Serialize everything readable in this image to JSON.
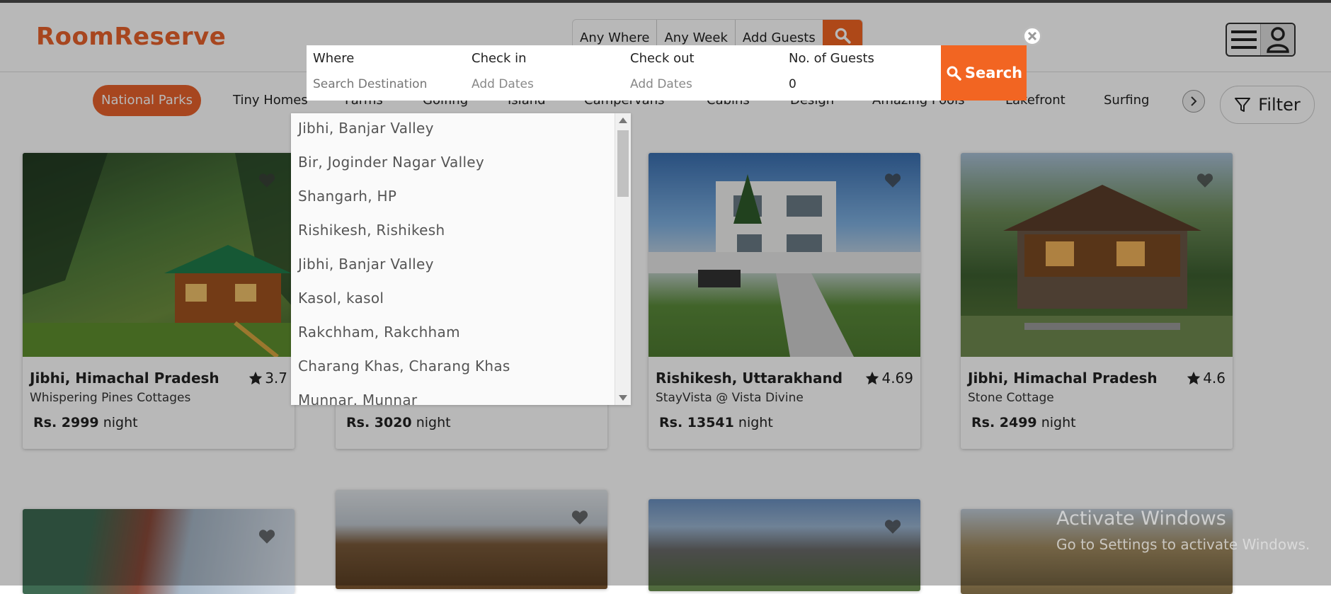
{
  "header": {
    "logo": "RoomReserve",
    "mini_search": {
      "where": "Any Where",
      "week": "Any Week",
      "guests": "Add Guests"
    }
  },
  "categories": {
    "items": [
      "National Parks",
      "Tiny Homes",
      "Farms",
      "Golfing",
      "Island",
      "Campervans",
      "Cabins",
      "Design",
      "Amazing Pools",
      "Lakefront",
      "Surfing"
    ],
    "active": "National Parks",
    "filter_label": "Filter"
  },
  "search_panel": {
    "where_label": "Where",
    "where_placeholder": "Search Destination",
    "checkin_label": "Check in",
    "checkin_value": "Add Dates",
    "checkout_label": "Check out",
    "checkout_value": "Add Dates",
    "guests_label": "No. of Guests",
    "guests_value": "0",
    "search_label": "Search"
  },
  "destinations": [
    "Jibhi, Banjar Valley",
    "Bir, Joginder Nagar Valley",
    "Shangarh, HP",
    "Rishikesh, Rishikesh",
    "Jibhi, Banjar Valley",
    "Kasol, kasol",
    "Rakchham, Rakchham",
    "Charang Khas, Charang Khas",
    "Munnar, Munnar"
  ],
  "listings": [
    {
      "location": "Jibhi, Himachal Pradesh",
      "rating": "3.7",
      "name": "Whispering Pines Cottages",
      "price": "Rs. 2999",
      "unit": "night"
    },
    {
      "location": "",
      "rating": "",
      "name": "",
      "price": "Rs. 3020",
      "unit": "night"
    },
    {
      "location": "Rishikesh, Uttarakhand",
      "rating": "4.69",
      "name": "StayVista @ Vista Divine",
      "price": "Rs. 13541",
      "unit": "night"
    },
    {
      "location": "Jibhi, Himachal Pradesh",
      "rating": "4.6",
      "name": "Stone Cottage",
      "price": "Rs. 2499",
      "unit": "night"
    }
  ],
  "watermark": {
    "line1": "Activate Windows",
    "line2": "Go to Settings to activate Windows."
  },
  "colors": {
    "accent": "#f26522",
    "brand": "#e8612c"
  }
}
